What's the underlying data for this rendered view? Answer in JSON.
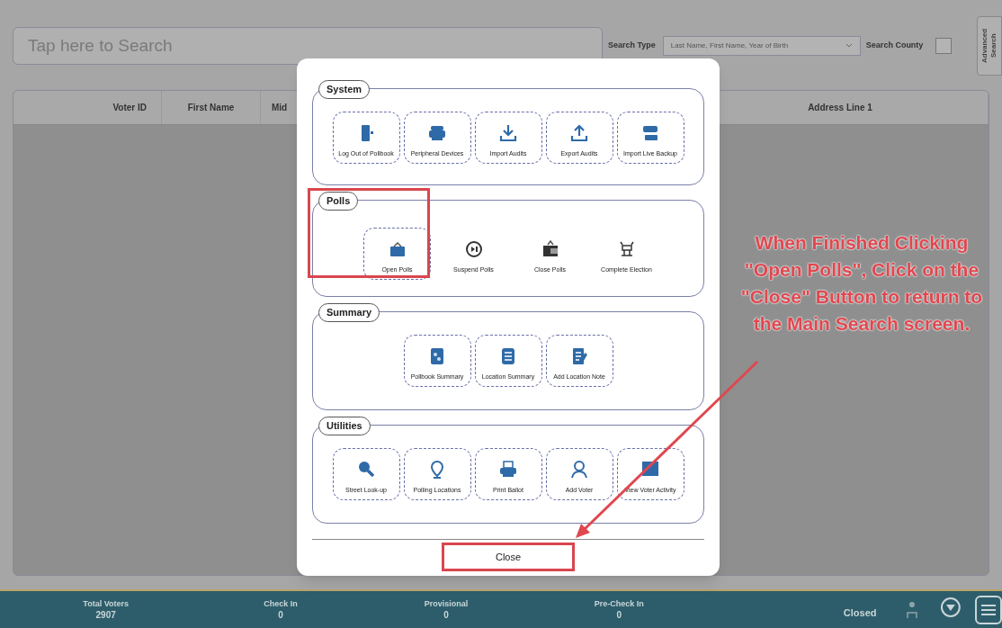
{
  "search": {
    "placeholder": "Tap here to Search",
    "type_label": "Search Type",
    "type_value": "Last Name, First Name, Year of Birth",
    "county_label": "Search County",
    "county_checked": false,
    "advanced": "Advanced Search"
  },
  "table": {
    "columns": [
      "Voter ID",
      "First Name",
      "Mid",
      "Address Line 1"
    ]
  },
  "dialog": {
    "sections": [
      {
        "title": "System",
        "buttons": [
          {
            "label": "Log Out of Pollbook",
            "disabled": false,
            "highlighted": false
          },
          {
            "label": "Peripheral Devices",
            "disabled": false,
            "highlighted": false
          },
          {
            "label": "Import Audits",
            "disabled": false,
            "highlighted": false
          },
          {
            "label": "Export Audits",
            "disabled": false,
            "highlighted": false
          },
          {
            "label": "Import Live Backup",
            "disabled": false,
            "highlighted": false
          }
        ]
      },
      {
        "title": "Polls",
        "buttons": [
          {
            "label": "Open Polls",
            "disabled": false,
            "highlighted": true
          },
          {
            "label": "Suspend Polls",
            "disabled": true,
            "highlighted": false
          },
          {
            "label": "Close Polls",
            "disabled": true,
            "highlighted": false
          },
          {
            "label": "Complete Election",
            "disabled": true,
            "highlighted": false
          }
        ]
      },
      {
        "title": "Summary",
        "buttons": [
          {
            "label": "Pollbook Summary",
            "disabled": false,
            "highlighted": false
          },
          {
            "label": "Location Summary",
            "disabled": false,
            "highlighted": false
          },
          {
            "label": "Add Location Note",
            "disabled": false,
            "highlighted": false
          }
        ]
      },
      {
        "title": "Utilities",
        "buttons": [
          {
            "label": "Street Look-up",
            "disabled": false,
            "highlighted": false
          },
          {
            "label": "Polling Locations",
            "disabled": false,
            "highlighted": false
          },
          {
            "label": "Print Ballot",
            "disabled": false,
            "highlighted": false
          },
          {
            "label": "Add Voter",
            "disabled": false,
            "highlighted": false
          },
          {
            "label": "View Voter Activity",
            "disabled": false,
            "highlighted": false
          }
        ]
      }
    ],
    "close": {
      "label": "Close",
      "highlighted": true
    }
  },
  "annotation": {
    "text": "When Finished Clicking \"Open Polls\", Click on the \"Close\" Button to return to the Main Search screen."
  },
  "status_bar": {
    "stats": [
      {
        "label": "Total Voters",
        "value": "2907"
      },
      {
        "label": "Check In",
        "value": "0"
      },
      {
        "label": "Provisional",
        "value": "0"
      },
      {
        "label": "Pre-Check In",
        "value": "0"
      }
    ],
    "polls_status": "Closed"
  }
}
